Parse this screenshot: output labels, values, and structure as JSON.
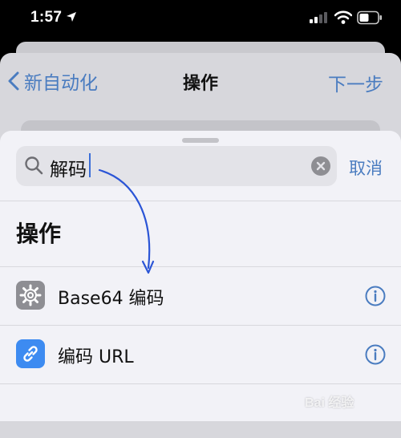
{
  "status_bar": {
    "time": "1:57"
  },
  "nav": {
    "back_label": "新自动化",
    "title": "操作",
    "next_label": "下一步"
  },
  "search": {
    "value": "解码",
    "cancel_label": "取消"
  },
  "section": {
    "title": "操作"
  },
  "actions": [
    {
      "label": "Base64 编码",
      "icon": "gear-icon",
      "icon_color": "#8e8e93"
    },
    {
      "label": "编码 URL",
      "icon": "link-icon",
      "icon_color": "#3d8bf1"
    }
  ],
  "colors": {
    "accent": "#4a7cc0",
    "annotation_arrow": "#2b55d6"
  },
  "watermark": "Bai 经验"
}
